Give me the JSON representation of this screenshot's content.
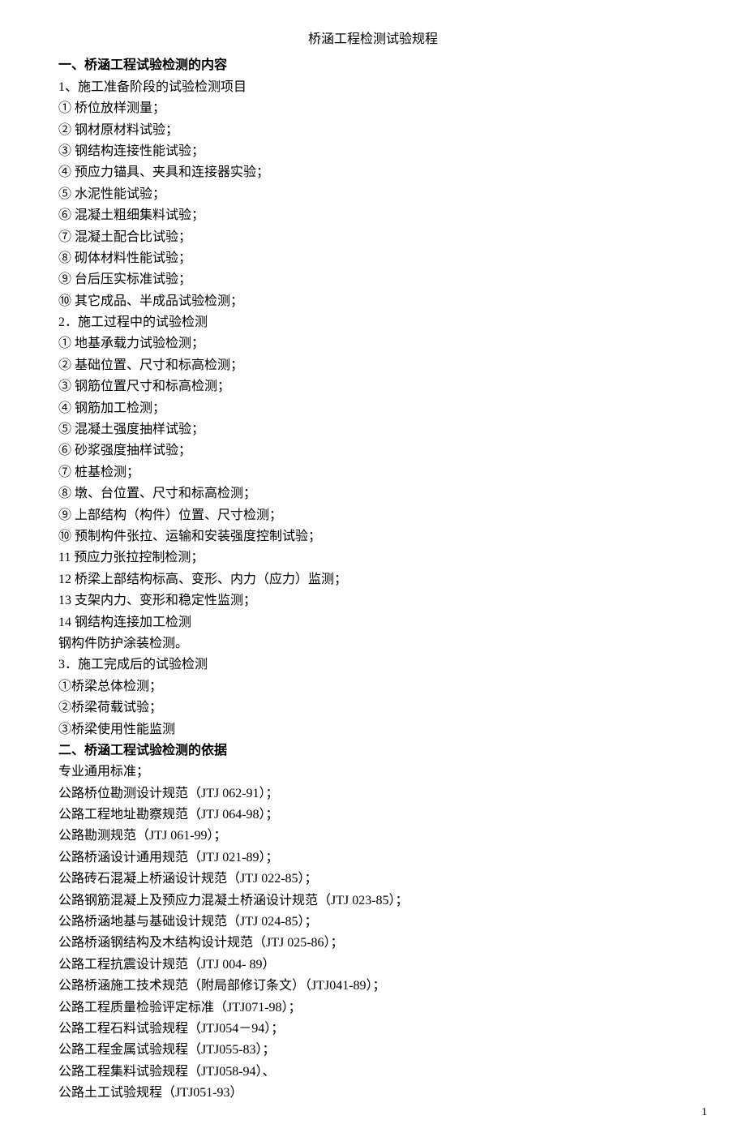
{
  "title": "桥涵工程检测试验规程",
  "section1": {
    "heading": "一、桥涵工程试验检测的内容",
    "sub1": "1、施工准备阶段的试验检测项目",
    "items1": [
      "① 桥位放样测量；",
      "② 钢材原材料试验；",
      "③ 钢结构连接性能试验；",
      "④ 预应力锚具、夹具和连接器实验；",
      "⑤ 水泥性能试验；",
      "⑥ 混凝土粗细集料试验；",
      "⑦ 混凝土配合比试验；",
      "⑧ 砌体材料性能试验；",
      "⑨ 台后压实标准试验；",
      "⑩ 其它成品、半成品试验检测；"
    ],
    "sub2": "2．施工过程中的试验检测",
    "items2": [
      "① 地基承载力试验检测；",
      "② 基础位置、尺寸和标高检测；",
      "③ 钢筋位置尺寸和标高检测；",
      "④ 钢筋加工检测；",
      "⑤ 混凝土强度抽样试验；",
      "⑥ 砂浆强度抽样试验；",
      "⑦ 桩基检测；",
      "⑧ 墩、台位置、尺寸和标高检测；",
      "⑨ 上部结构（构件）位置、尺寸检测；",
      "⑩ 预制构件张拉、运输和安装强度控制试验；",
      "11 预应力张拉控制检测；",
      "12 桥梁上部结构标高、变形、内力（应力）监测；",
      "13 支架内力、变形和稳定性监测；",
      "14 钢结构连接加工检测",
      "钢构件防护涂装检测。"
    ],
    "sub3": "3．施工完成后的试验检测",
    "items3": [
      "①桥梁总体检测；",
      "②桥梁荷载试验；",
      "③桥梁使用性能监测"
    ]
  },
  "section2": {
    "heading": "二、桥涵工程试验检测的依据",
    "items": [
      "专业通用标准；",
      "公路桥位勘测设计规范（JTJ 062-91）；",
      "公路工程地址勘察规范（JTJ 064-98）；",
      "公路勘测规范（JTJ 061-99）；",
      "公路桥涵设计通用规范（JTJ 021-89）；",
      "公路砖石混凝上桥涵设计规范（JTJ 022-85）；",
      "公路钢筋混凝上及预应力混凝土桥涵设计规范（JTJ 023-85）；",
      "公路桥涵地基与基础设计规范（JTJ 024-85）；",
      "公路桥涵钢结构及木结构设计规范（JTJ 025-86）；",
      "公路工程抗震设计规范（JTJ 004- 89）",
      "公路桥涵施工技术规范（附局部修订条文）（JTJ041-89）；",
      "公路工程质量检验评定标准（JTJ071-98）；",
      "公路工程石料试验规程（JTJ054－94）；",
      "公路工程金属试验规程（JTJ055-83）；",
      "公路工程集料试验规程（JTJ058-94）、",
      "公路土工试验规程（JTJ051-93）"
    ]
  },
  "pageNumber": "1"
}
